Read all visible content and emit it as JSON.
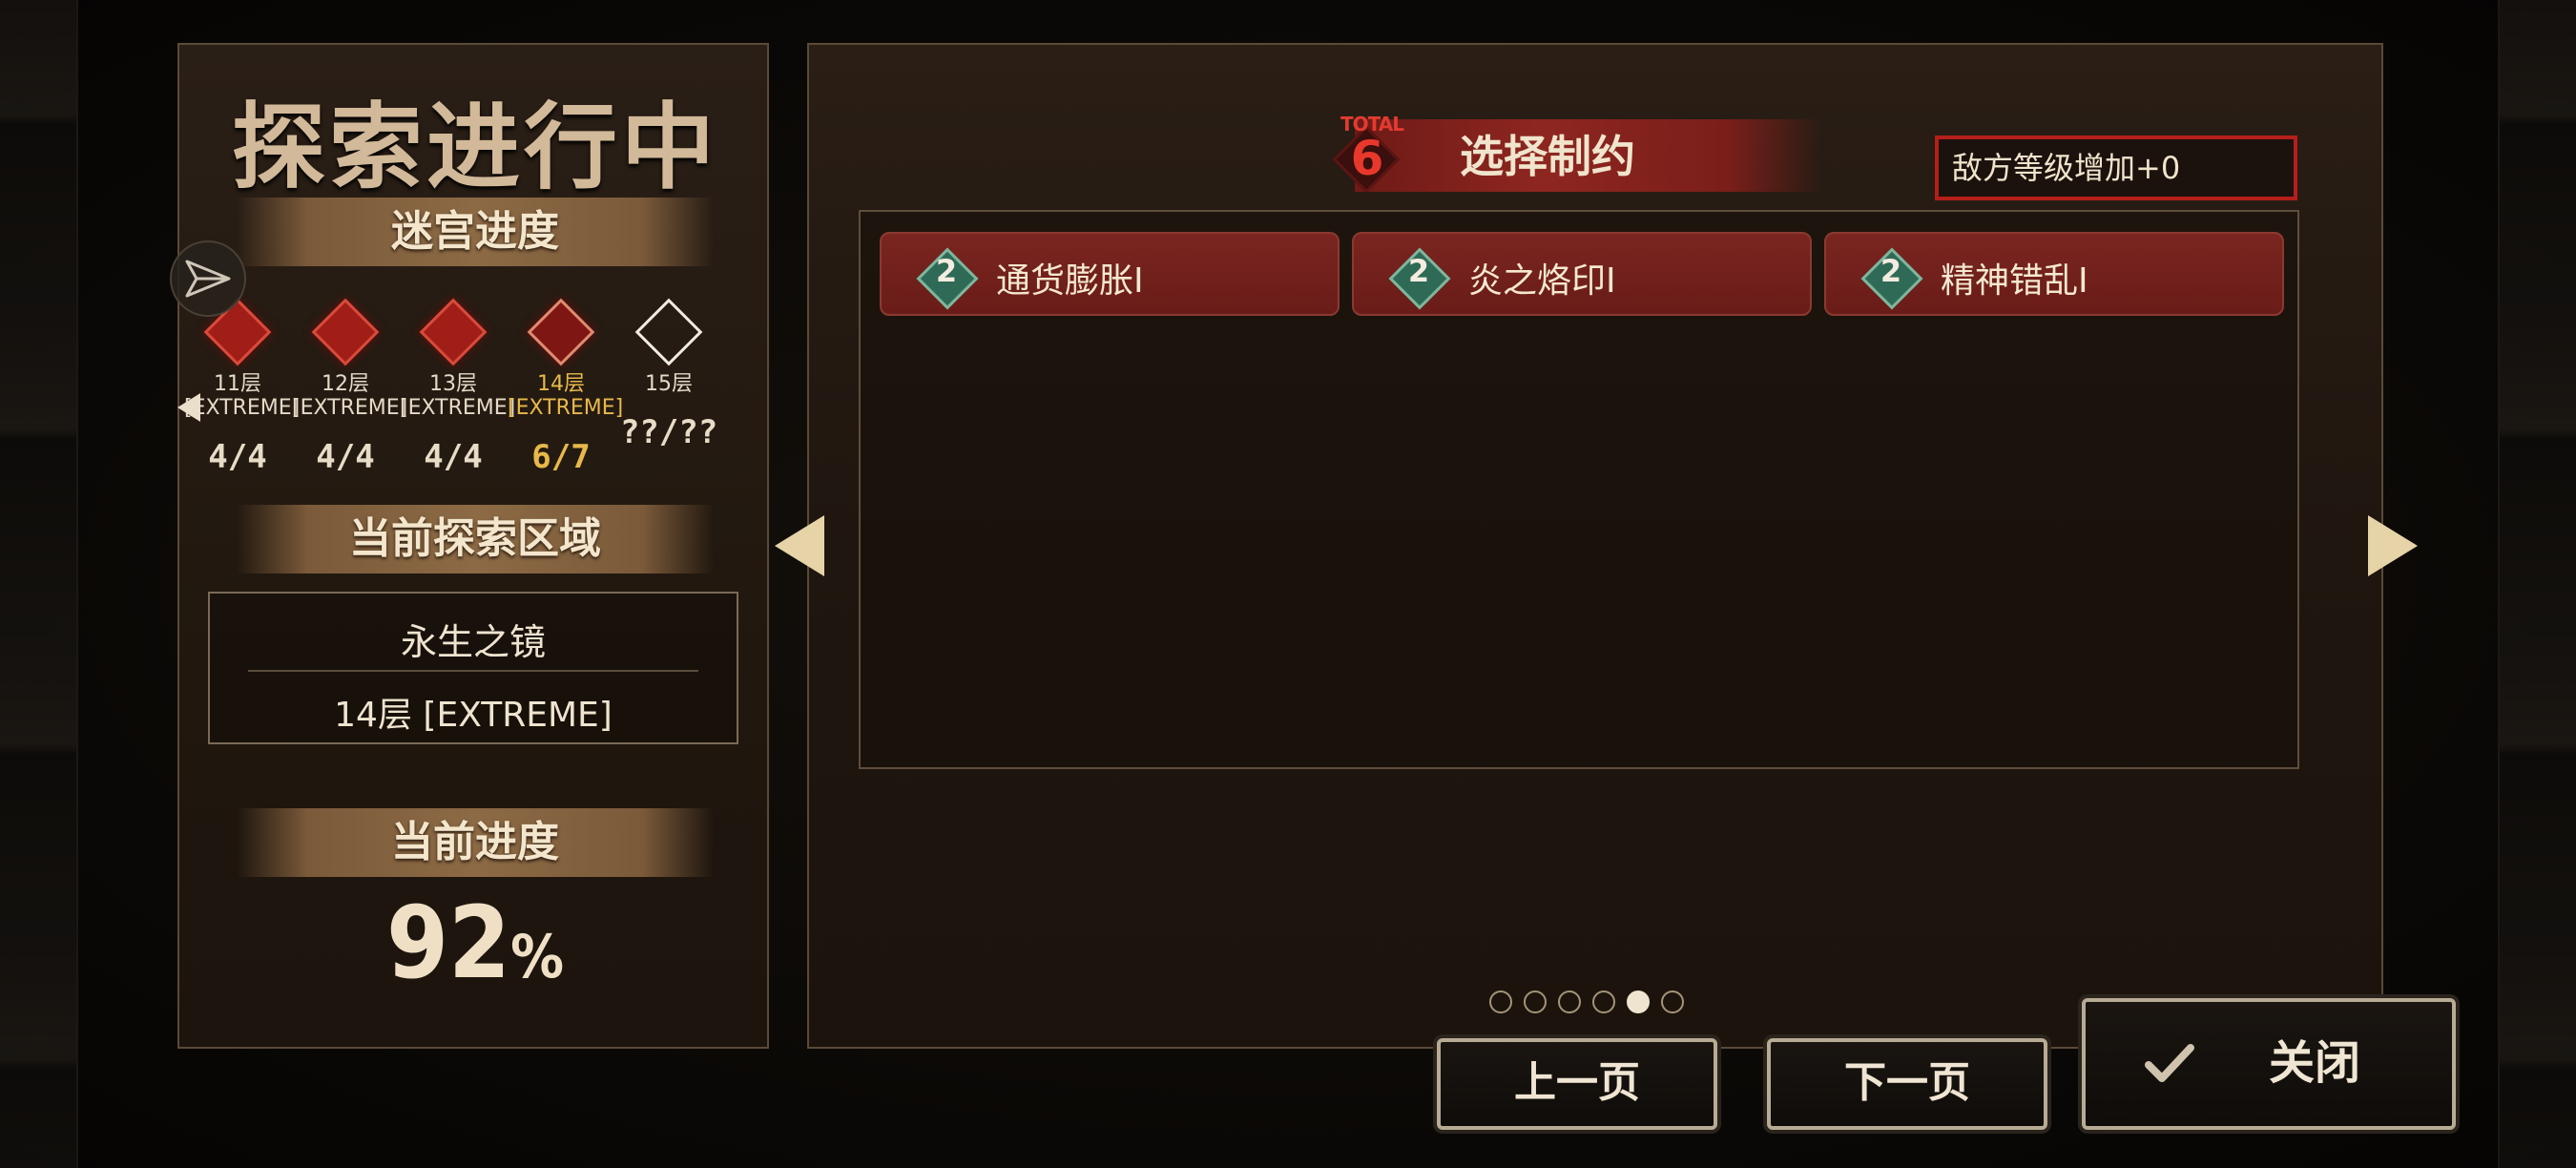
{
  "left": {
    "title": "探索进行中",
    "maze_progress_label": "迷宫进度",
    "floors": [
      {
        "name": "11层",
        "difficulty": "[EXTREME]",
        "count": "4/4",
        "state": "done"
      },
      {
        "name": "12层",
        "difficulty": "[EXTREME]",
        "count": "4/4",
        "state": "done"
      },
      {
        "name": "13层",
        "difficulty": "[EXTREME]",
        "count": "4/4",
        "state": "done"
      },
      {
        "name": "14层",
        "difficulty": "[EXTREME]",
        "count": "6/7",
        "state": "current"
      },
      {
        "name": "15层",
        "difficulty": "",
        "count": "??/??",
        "state": "locked"
      }
    ],
    "current_area_label": "当前探索区域",
    "area_name": "永生之镜",
    "area_floor": "14层 [EXTREME]",
    "current_progress_label": "当前进度",
    "progress_value": "92",
    "progress_unit": "%"
  },
  "right": {
    "total_label": "TOTAL",
    "total_value": "6",
    "header_title": "选择制约",
    "enemy_level": "敌方等级增加+0",
    "restrictions": [
      {
        "level": "2",
        "label": "通货膨胀I"
      },
      {
        "level": "2",
        "label": "炎之烙印I"
      },
      {
        "level": "2",
        "label": "精神错乱I"
      }
    ],
    "page_count": 6,
    "current_page": 5
  },
  "buttons": {
    "prev": "上一页",
    "next": "下一页",
    "close": "关闭"
  },
  "colors": {
    "accent_red": "#a11d18",
    "gold": "#e8b84a",
    "cream": "#efe4cf",
    "teal_badge": "#2f6a56"
  }
}
